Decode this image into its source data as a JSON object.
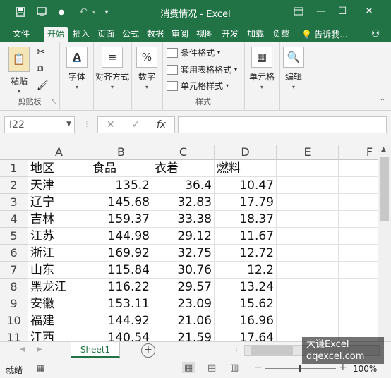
{
  "titlebar": {
    "title": "消费情况 - Excel",
    "accent": "#217346"
  },
  "tabs": [
    {
      "label": "文件"
    },
    {
      "label": "开始"
    },
    {
      "label": "插入"
    },
    {
      "label": "页面"
    },
    {
      "label": "公式"
    },
    {
      "label": "数据"
    },
    {
      "label": "审阅"
    },
    {
      "label": "视图"
    },
    {
      "label": "开发"
    },
    {
      "label": "加载"
    },
    {
      "label": "负载"
    }
  ],
  "tell_me": "告诉我...",
  "ribbon": {
    "paste": "粘贴",
    "clipboard_group": "剪贴板",
    "font": "字体",
    "align": "对齐方式",
    "number": "数字",
    "styles": {
      "conditional": "条件格式",
      "table": "套用表格格式",
      "cell_style": "单元格样式",
      "group": "样式"
    },
    "cells": "单元格",
    "edit": "编辑"
  },
  "formula_bar": {
    "name_box": "I22",
    "fx": "fx",
    "content": ""
  },
  "sheet": {
    "columns": [
      "A",
      "B",
      "C",
      "D",
      "E",
      "F"
    ],
    "row_numbers": [
      "1",
      "2",
      "3",
      "4",
      "5",
      "6",
      "7",
      "8",
      "9",
      "10",
      "11"
    ],
    "header": [
      "地区",
      "食品",
      "衣着",
      "燃料"
    ],
    "rows": [
      [
        "天津",
        "135.2",
        "36.4",
        "10.47"
      ],
      [
        "辽宁",
        "145.68",
        "32.83",
        "17.79"
      ],
      [
        "吉林",
        "159.37",
        "33.38",
        "18.37"
      ],
      [
        "江苏",
        "144.98",
        "29.12",
        "11.67"
      ],
      [
        "浙江",
        "169.92",
        "32.75",
        "12.72"
      ],
      [
        "山东",
        "115.84",
        "30.76",
        "12.2"
      ],
      [
        "黑龙江",
        "116.22",
        "29.57",
        "13.24"
      ],
      [
        "安徽",
        "153.11",
        "23.09",
        "15.62"
      ],
      [
        "福建",
        "144.92",
        "21.06",
        "16.96"
      ],
      [
        "江西",
        "140.54",
        "21.59",
        "17.64"
      ]
    ]
  },
  "sheet_tab": "Sheet1",
  "status": {
    "ready": "就绪",
    "zoom": "100%"
  },
  "watermark": {
    "line1": "大谦Excel",
    "line2": "dqexcel.com"
  }
}
